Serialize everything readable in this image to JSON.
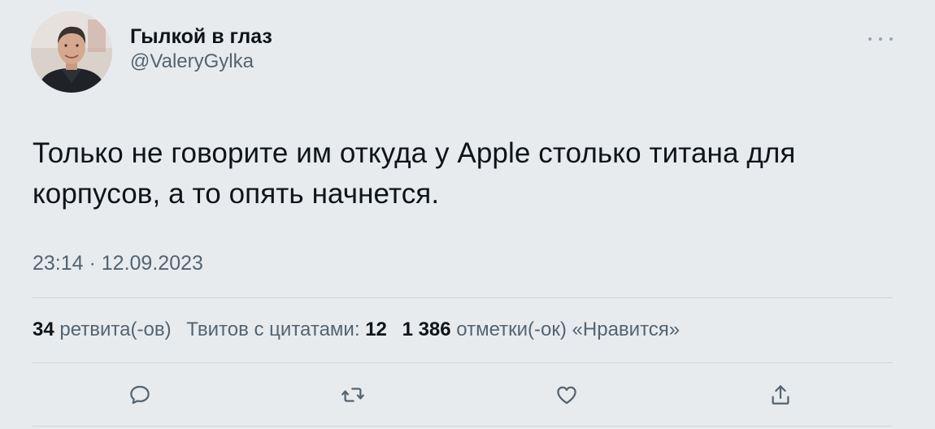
{
  "author": {
    "display_name": "Гылкой в глаз",
    "handle": "@ValeryGylka",
    "avatar_icon": "profile-photo"
  },
  "tweet": {
    "text": "Только не говорите им откуда у Apple столько титана для корпусов, а то опять начнется.",
    "timestamp": "23:14 · 12.09.2023"
  },
  "stats": {
    "retweets_count": "34",
    "retweets_label": "ретвита(-ов)",
    "quotes_label": "Твитов с цитатами:",
    "quotes_count": "12",
    "likes_count": "1 386",
    "likes_label": "отметки(-ок) «Нравится»"
  },
  "actions": [
    {
      "name": "reply",
      "icon": "speech-bubble-icon"
    },
    {
      "name": "retweet",
      "icon": "retweet-icon"
    },
    {
      "name": "like",
      "icon": "heart-icon"
    },
    {
      "name": "share",
      "icon": "share-icon"
    }
  ],
  "colors": {
    "background": "#e8ebee",
    "text_primary": "#0f1419",
    "text_secondary": "#536471"
  }
}
